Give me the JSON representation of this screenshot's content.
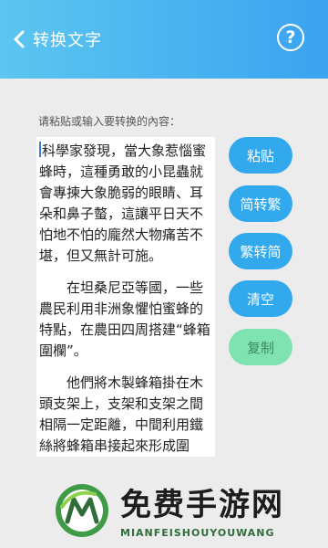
{
  "app_bar": {
    "title": "转换文字",
    "help_symbol": "?",
    "back_icon": "chevron-left-icon",
    "colors": {
      "gradient_start": "#5cc6f0",
      "gradient_end": "#3ba3f0"
    }
  },
  "editor": {
    "prompt": "请粘贴或输入要转换的內容：",
    "paragraphs": [
      "科學家發現，當大象惹惱蜜蜂時，這種勇敢的小昆蟲就會專揀大象脆弱的眼睛、耳朵和鼻子螫，這讓平日天不怕地不怕的龐然大物痛苦不堪，但又無計可施。",
      "　　在坦桑尼亞等國，一些農民利用非洲象懼怕蜜蜂的特點，在農田四周搭建“蜂箱圍欄”。",
      "　　他們將木製蜂箱掛在木頭支架上，支架和支架之間相隔一定距離，中間利用鐵絲將蜂箱串接起來形成圍欄。這樣每當有大象想要硬"
    ]
  },
  "actions": {
    "paste": "粘贴",
    "to_traditional": "简转繁",
    "to_simplified": "繁转简",
    "clear": "清空",
    "copy": "复制",
    "colors": {
      "primary": "#31a9ec",
      "secondary": "#7ee3b1"
    }
  },
  "watermark": {
    "name": "免费手游网",
    "domain": "MIANFEISHOUYOUWANG"
  }
}
